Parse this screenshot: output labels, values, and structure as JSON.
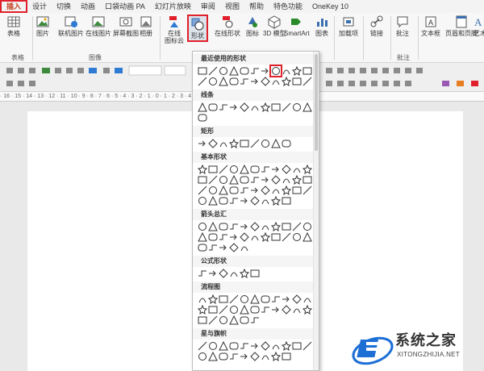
{
  "tabs": [
    {
      "label": "插入",
      "active": true
    },
    {
      "label": "设计"
    },
    {
      "label": "切换"
    },
    {
      "label": "动画"
    },
    {
      "label": "口袋动画 PA"
    },
    {
      "label": "幻灯片放映"
    },
    {
      "label": "审阅"
    },
    {
      "label": "视图"
    },
    {
      "label": "帮助"
    },
    {
      "label": "特色功能"
    },
    {
      "label": "OneKey 10"
    }
  ],
  "ribbon": {
    "buttons": [
      {
        "label": "表格",
        "icon": "table-icon"
      },
      {
        "label": "图片",
        "icon": "picture-icon"
      },
      {
        "label": "联机图片",
        "icon": "online-picture-icon"
      },
      {
        "label": "在线图片",
        "icon": "online-image-icon"
      },
      {
        "label": "屏幕截图",
        "icon": "screenshot-icon"
      },
      {
        "label": "相册",
        "icon": "album-icon"
      },
      {
        "label": "在线",
        "icon": "online-icon"
      },
      {
        "label": "形状",
        "icon": "shapes-icon",
        "highlight": true
      },
      {
        "label": "在线形状",
        "icon": "online-shapes-icon"
      },
      {
        "label": "图标",
        "icon": "icons-icon"
      },
      {
        "label": "3D 模型",
        "icon": "3d-model-icon"
      },
      {
        "label": "SmartArt",
        "icon": "smartart-icon"
      },
      {
        "label": "图表",
        "icon": "chart-icon"
      },
      {
        "label": "加载项",
        "icon": "addins-icon"
      },
      {
        "label": "链接",
        "icon": "link-icon"
      },
      {
        "label": "批注",
        "icon": "comment-icon"
      },
      {
        "label": "文本框",
        "icon": "textbox-icon"
      },
      {
        "label": "页眉和页脚",
        "icon": "header-footer-icon"
      },
      {
        "label": "艺术",
        "icon": "wordart-icon"
      }
    ],
    "sublabel": "图标云",
    "groups": [
      "表格",
      "图像",
      "批注"
    ]
  },
  "ruler_text": "· 16 · 15 · 14 · 13 · 12 · 11 · 10 · 9 · 8 · 7 · 6 · 5 · 4 · 3 · 2 · 1 · 0 · 1 · 2 · 3 · 4 · 5 · 6 · 7 · 8 · 9 · 10 · 11 · 12 · 13 · 14 · 15 · 16 ·",
  "dropdown": {
    "sections": [
      {
        "title": "最近使用的形状",
        "count": 22,
        "highlight_index": 7
      },
      {
        "title": "线条",
        "count": 12
      },
      {
        "title": "矩形",
        "count": 9
      },
      {
        "title": "基本形状",
        "count": 42
      },
      {
        "title": "箭头总汇",
        "count": 27
      },
      {
        "title": "公式形状",
        "count": 6
      },
      {
        "title": "流程图",
        "count": 28
      },
      {
        "title": "星与旗帜",
        "count": 20
      }
    ]
  },
  "watermark": {
    "title": "系统之家",
    "url": "XITONGZHIJIA.NET"
  },
  "colors": {
    "highlight": "#e0202a",
    "accent": "#c43e1c",
    "logo_blue": "#1d6fd6"
  }
}
